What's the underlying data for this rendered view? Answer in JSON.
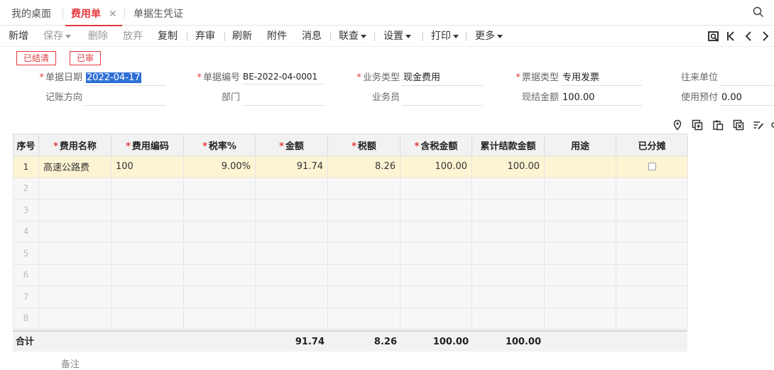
{
  "tabs": [
    {
      "label": "我的桌面"
    },
    {
      "label": "费用单"
    },
    {
      "label": "单据生凭证"
    }
  ],
  "toolbar": {
    "new": "新增",
    "save": "保存",
    "delete": "删除",
    "abandon": "放弃",
    "copy": "复制",
    "unaudit": "弃审",
    "refresh": "刷新",
    "attachment": "附件",
    "message": "消息",
    "link": "联查",
    "settings": "设置",
    "print": "打印",
    "more": "更多"
  },
  "badges": {
    "settled": "已结清",
    "audited": "已审"
  },
  "form": {
    "date_label": "单据日期",
    "date_value": "2022-04-17",
    "number_label": "单据编号",
    "number_value": "BE-2022-04-0001",
    "biz_type_label": "业务类型",
    "biz_type_value": "现金费用",
    "invoice_type_label": "票据类型",
    "invoice_type_value": "专用发票",
    "partner_label": "往来单位",
    "partner_value": "",
    "direction_label": "记账方向",
    "direction_value": "",
    "dept_label": "部门",
    "dept_value": "",
    "salesman_label": "业务员",
    "salesman_value": "",
    "cash_amount_label": "现结金额",
    "cash_amount_value": "100.00",
    "prepay_label": "使用预付",
    "prepay_value": "0.00"
  },
  "grid": {
    "headers": {
      "index": "序号",
      "name": "费用名称",
      "code": "费用编码",
      "rate": "税率%",
      "amount": "金额",
      "tax": "税额",
      "total": "含税金额",
      "settled": "累计结款金额",
      "purpose": "用途",
      "allocated": "已分摊"
    },
    "rows": [
      {
        "index": "1",
        "name": "高速公路费",
        "code": "100",
        "rate": "9.00%",
        "amount": "91.74",
        "tax": "8.26",
        "total": "100.00",
        "settled": "100.00",
        "purpose": ""
      },
      {
        "index": "2"
      },
      {
        "index": "3"
      },
      {
        "index": "4"
      },
      {
        "index": "5"
      },
      {
        "index": "6"
      },
      {
        "index": "7"
      },
      {
        "index": "8"
      }
    ],
    "totals": {
      "label": "合计",
      "amount": "91.74",
      "tax": "8.26",
      "total": "100.00",
      "settled": "100.00"
    }
  },
  "remark_label": "备注",
  "colors": {
    "accent": "#e4393c",
    "row_highlight": "#fdf4d4"
  }
}
